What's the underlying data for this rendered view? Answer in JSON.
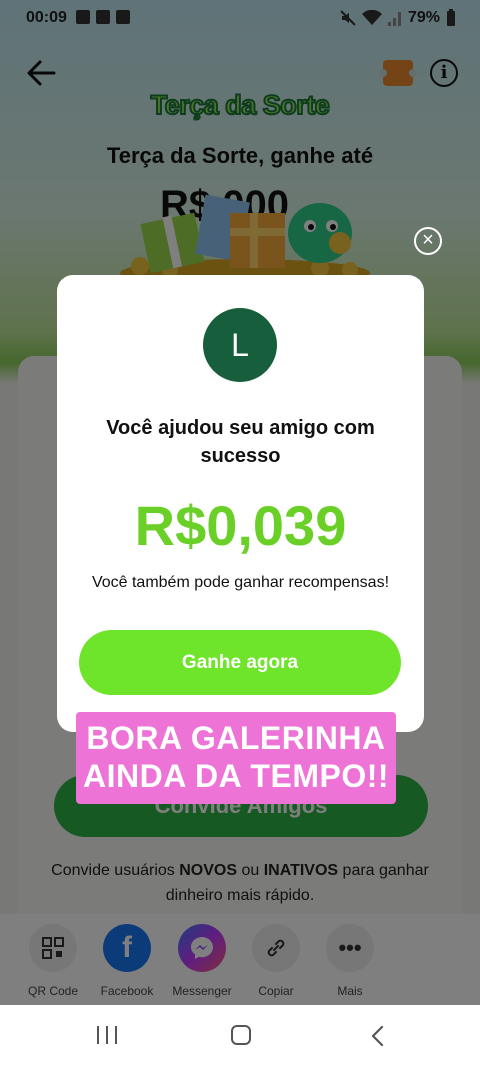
{
  "status": {
    "time": "00:09",
    "battery": "79%"
  },
  "header": {
    "logo": "Terça da Sorte",
    "headline": "Terça da Sorte, ganhe até",
    "amount": "R$ 000"
  },
  "modal": {
    "avatar_letter": "L",
    "title": "Você ajudou seu amigo com sucesso",
    "amount": "R$0,039",
    "subtitle": "Você também pode ganhar recompensas!",
    "cta": "Ganhe agora"
  },
  "sticker": {
    "line1": "BORA GALERINHA",
    "line2": "AINDA DA TEMPO!!"
  },
  "invite": {
    "button": "Convide Amigos",
    "text_pre": "Convide usuários ",
    "text_new": "NOVOS",
    "text_mid": " ou ",
    "text_inactive": "INATIVOS",
    "text_post": " para ganhar dinheiro mais rápido."
  },
  "share": [
    {
      "label": "QR Code",
      "icon": "qr-code-icon"
    },
    {
      "label": "Facebook",
      "icon": "facebook-icon"
    },
    {
      "label": "Messenger",
      "icon": "messenger-icon"
    },
    {
      "label": "Copiar",
      "icon": "link-icon"
    },
    {
      "label": "Mais",
      "icon": "more-icon"
    }
  ],
  "colors": {
    "accent_green": "#6ee52a",
    "amount_green": "#6ad028",
    "sticker_pink": "#ee73d7",
    "avatar_bg": "#175e3d"
  }
}
